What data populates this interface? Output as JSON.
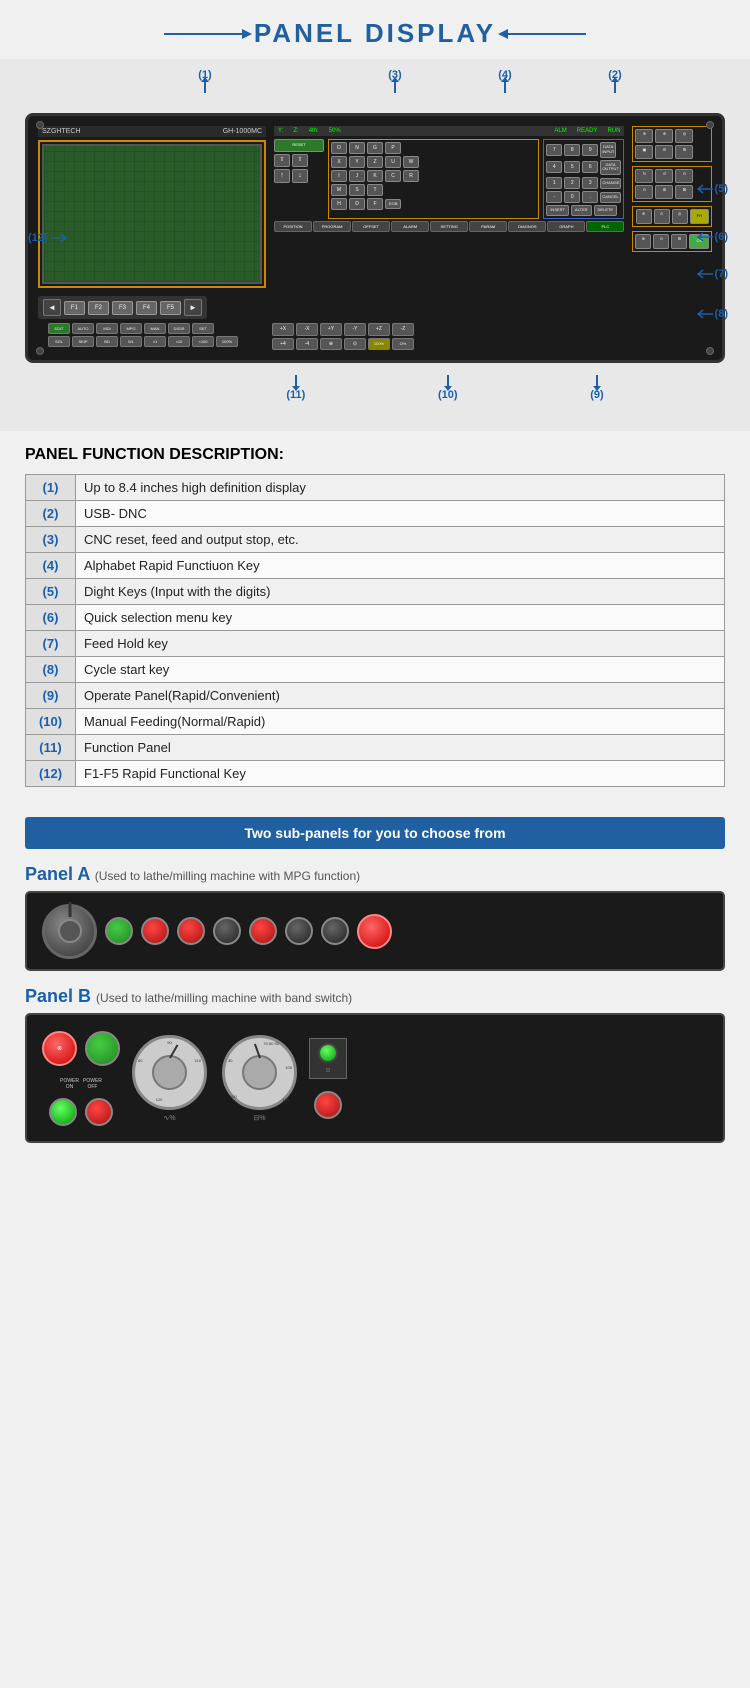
{
  "page": {
    "title": "PANEL DISPLAY"
  },
  "header": {
    "title": "PANEL DISPLAY"
  },
  "cnc_panel": {
    "brand": "SZGHTECH",
    "model": "GH-1000MC",
    "status_bar": [
      "Y:",
      "Z:",
      "4th:",
      "50%",
      "ALM",
      "READY",
      "RUN"
    ]
  },
  "annotations_top": [
    {
      "id": "(1)",
      "label": "(1)"
    },
    {
      "id": "(3)",
      "label": "(3)"
    },
    {
      "id": "(4)",
      "label": "(4)"
    },
    {
      "id": "(2)",
      "label": "(2)"
    }
  ],
  "annotations_side_right": [
    {
      "id": "(5)",
      "label": "(5)"
    },
    {
      "id": "(6)",
      "label": "(6)"
    },
    {
      "id": "(7)",
      "label": "(7)"
    },
    {
      "id": "(8)",
      "label": "(8)"
    }
  ],
  "annotations_bottom": [
    {
      "id": "(11)",
      "label": "(11)"
    },
    {
      "id": "(10)",
      "label": "(10)"
    },
    {
      "id": "(9)",
      "label": "(9)"
    }
  ],
  "annotation_left": "(12)",
  "function_table": {
    "title": "PANEL FUNCTION DESCRIPTION:",
    "rows": [
      {
        "id": "(1)",
        "description": "Up to 8.4 inches high definition display"
      },
      {
        "id": "(2)",
        "description": "USB- DNC"
      },
      {
        "id": "(3)",
        "description": "CNC reset, feed and output stop, etc."
      },
      {
        "id": "(4)",
        "description": "Alphabet Rapid Functiuon Key"
      },
      {
        "id": "(5)",
        "description": "Dight Keys (Input with the digits)"
      },
      {
        "id": "(6)",
        "description": "Quick selection menu key"
      },
      {
        "id": "(7)",
        "description": "Feed Hold key"
      },
      {
        "id": "(8)",
        "description": "Cycle start key"
      },
      {
        "id": "(9)",
        "description": "Operate Panel(Rapid/Convenient)"
      },
      {
        "id": "(10)",
        "description": "Manual Feeding(Normal/Rapid)"
      },
      {
        "id": "(11)",
        "description": "Function Panel"
      },
      {
        "id": "(12)",
        "description": "F1-F5 Rapid Functional Key"
      }
    ]
  },
  "sub_panels": {
    "banner": "Two sub-panels for you to choose from",
    "panel_a": {
      "label": "Panel A",
      "sublabel": "(Used to lathe/milling machine with MPG function)"
    },
    "panel_b": {
      "label": "Panel B",
      "sublabel": "(Used to lathe/milling machine with band switch)"
    }
  },
  "colors": {
    "blue": "#2060a0",
    "dark_blue": "#1a5faa",
    "green": "#44cc44",
    "red": "#cc0000"
  }
}
